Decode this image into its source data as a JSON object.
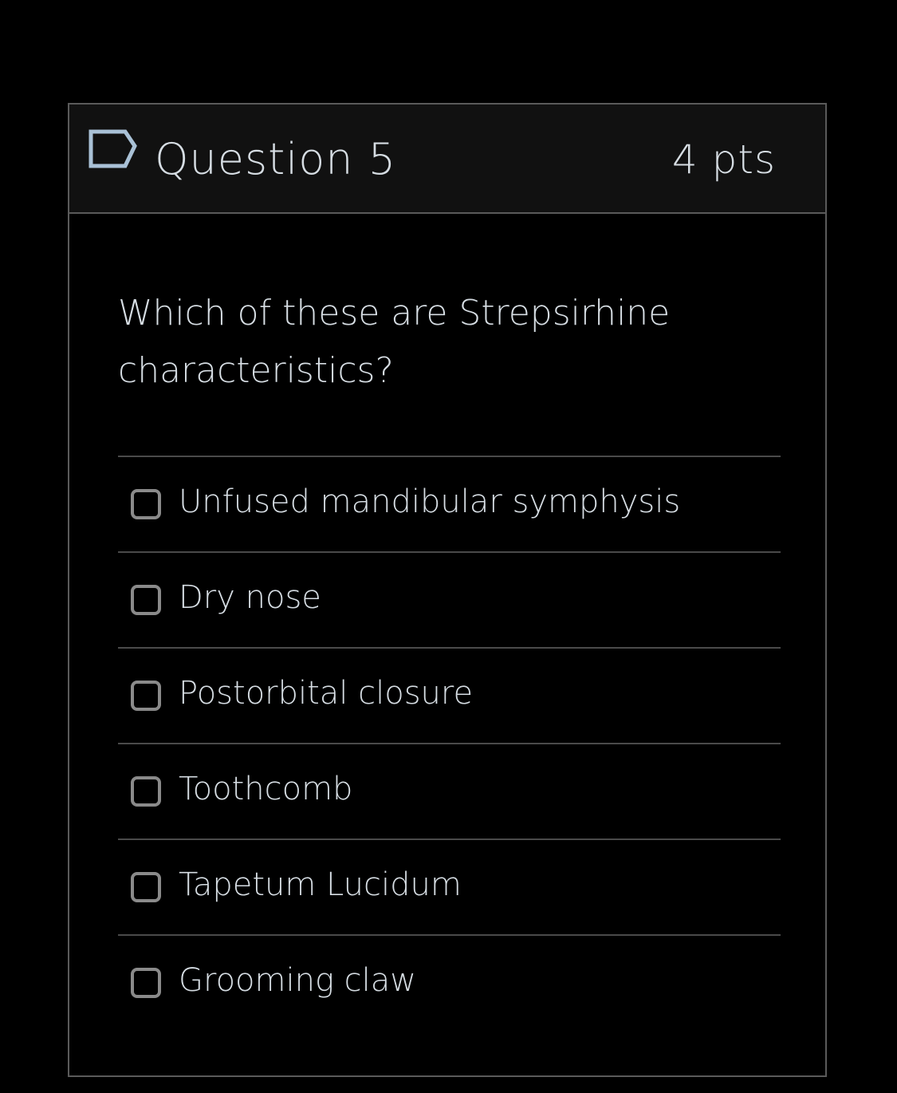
{
  "question": {
    "title": "Question 5",
    "points": "4 pts",
    "flag_icon": "flag-question-icon",
    "text": "Which of these are Strepsirhine characteristics?"
  },
  "answers": [
    {
      "label": "Unfused mandibular symphysis",
      "checked": false
    },
    {
      "label": "Dry nose",
      "checked": false
    },
    {
      "label": "Postorbital closure",
      "checked": false
    },
    {
      "label": "Toothcomb",
      "checked": false
    },
    {
      "label": "Tapetum Lucidum",
      "checked": false
    },
    {
      "label": "Grooming claw",
      "checked": false
    }
  ],
  "colors": {
    "background": "#000000",
    "header_background": "#111111",
    "border": "#5a5a5a",
    "text": "#d6dde3",
    "checkbox_border": "#8a8a8a",
    "flag_outline": "#a9c1d6"
  }
}
